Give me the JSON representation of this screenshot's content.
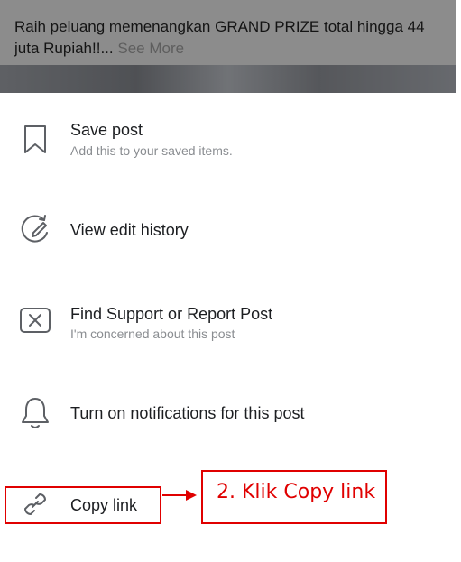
{
  "post": {
    "text": "Raih peluang memenangkan GRAND PRIZE total hingga 44 juta Rupiah!!...",
    "see_more": "See More"
  },
  "menu": {
    "items": [
      {
        "id": "save",
        "icon": "bookmark-icon",
        "title": "Save post",
        "subtitle": "Add this to your saved items."
      },
      {
        "id": "history",
        "icon": "edit-history-icon",
        "title": "View edit history",
        "subtitle": ""
      },
      {
        "id": "report",
        "icon": "report-icon",
        "title": "Find Support or Report Post",
        "subtitle": "I'm concerned about this post"
      },
      {
        "id": "notif",
        "icon": "bell-icon",
        "title": "Turn on notifications for this post",
        "subtitle": ""
      },
      {
        "id": "copy",
        "icon": "link-icon",
        "title": "Copy link",
        "subtitle": ""
      }
    ]
  },
  "annotation": {
    "callout": "2. Klik Copy link",
    "color": "#e00000"
  }
}
